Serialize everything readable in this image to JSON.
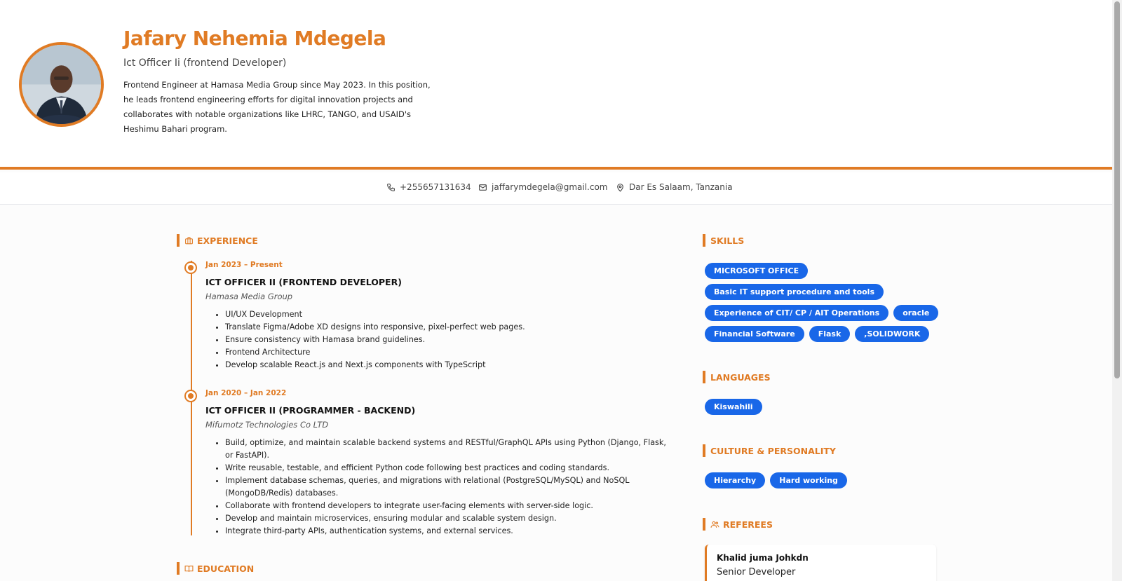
{
  "profile": {
    "name": "Jafary Nehemia Mdegela",
    "role": "Ict Officer Ii (frontend Developer)",
    "summary": "Frontend Engineer at Hamasa Media Group since May 2023. In this position, he leads frontend engineering efforts for digital innovation projects and collaborates with notable organizations like LHRC, TANGO, and USAID's Heshimu Bahari program."
  },
  "contact": {
    "phone": "+255657131634",
    "email": "jaffarymdegela@gmail.com",
    "location": "Dar Es Salaam, Tanzania"
  },
  "experience": {
    "heading": "EXPERIENCE",
    "jobs": [
      {
        "dates": "Jan 2023 – Present",
        "title": "ICT OFFICER II (FRONTEND DEVELOPER)",
        "company": "Hamasa Media Group",
        "bullets": [
          "UI/UX Development",
          "Translate Figma/Adobe XD designs into responsive, pixel-perfect web pages.",
          "Ensure consistency with Hamasa brand guidelines.",
          "Frontend Architecture",
          "Develop scalable React.js and Next.js components with TypeScript"
        ]
      },
      {
        "dates": "Jan 2020 – Jan 2022",
        "title": "ICT OFFICER II (PROGRAMMER - BACKEND)",
        "company": "Mifumotz Technologies Co LTD",
        "bullets": [
          "Build, optimize, and maintain scalable backend systems and RESTful/GraphQL APIs using Python (Django, Flask, or FastAPI).",
          "Write reusable, testable, and efficient Python code following best practices and coding standards.",
          "Implement database schemas, queries, and migrations with relational (PostgreSQL/MySQL) and NoSQL (MongoDB/Redis) databases.",
          "Collaborate with frontend developers to integrate user-facing elements with server-side logic.",
          "Develop and maintain microservices, ensuring modular and scalable system design.",
          "Integrate third-party APIs, authentication systems, and external services."
        ]
      }
    ]
  },
  "education": {
    "heading": "EDUCATION"
  },
  "skills": {
    "heading": "SKILLS",
    "items": [
      "MICROSOFT OFFICE",
      "Basic IT support procedure and tools",
      "Experience of CIT/ CP / AIT Operations",
      "oracle",
      "Financial Software",
      "Flask",
      ",SOLIDWORK"
    ]
  },
  "languages": {
    "heading": "LANGUAGES",
    "items": [
      "Kiswahili"
    ]
  },
  "culture": {
    "heading": "CULTURE & PERSONALITY",
    "items": [
      "Hierarchy",
      "Hard working"
    ]
  },
  "referees": {
    "heading": "REFEREES",
    "items": [
      {
        "name": "Khalid juma Johkdn",
        "role": "Senior Developer"
      }
    ]
  },
  "colors": {
    "accent": "#e07b24",
    "chip": "#1967e8"
  }
}
